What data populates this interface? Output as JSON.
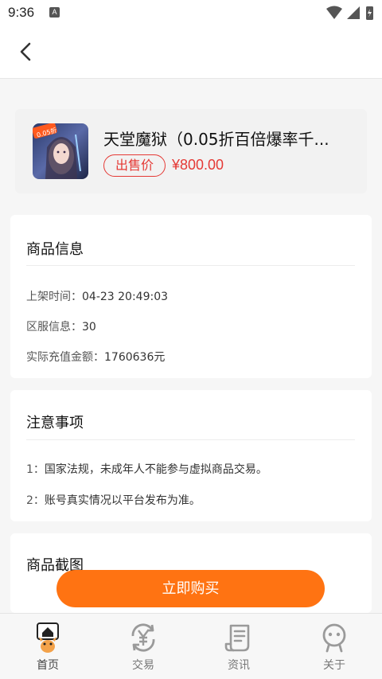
{
  "status_bar": {
    "time": "9:36",
    "notification_letter": "A"
  },
  "nav": {
    "back_icon": "chevron-left-icon"
  },
  "product": {
    "title": "天堂魔狱（0.05折百倍爆率千...",
    "sale_badge": "出售价",
    "price": "¥800.00",
    "thumbnail_badge": "0.05折"
  },
  "product_info": {
    "title": "商品信息",
    "rows": [
      {
        "label": "上架时间：",
        "value": "04-23 20:49:03"
      },
      {
        "label": "区服信息：",
        "value": "30"
      },
      {
        "label": "实际充值金额：",
        "value": "1760636元"
      }
    ]
  },
  "notes": {
    "title": "注意事项",
    "items": [
      {
        "num": "1：",
        "text": "国家法规，未成年人不能参与虚拟商品交易。"
      },
      {
        "num": "2：",
        "text": "账号真实情况以平台发布为准。"
      }
    ]
  },
  "screenshots": {
    "title": "商品截图"
  },
  "buy_button": "立即购买",
  "tabs": [
    {
      "label": "首页",
      "icon": "home-mascot-icon",
      "active": true
    },
    {
      "label": "交易",
      "icon": "yen-exchange-icon",
      "active": false
    },
    {
      "label": "资讯",
      "icon": "scroll-news-icon",
      "active": false
    },
    {
      "label": "关于",
      "icon": "face-icon",
      "active": false
    }
  ],
  "colors": {
    "accent": "#ff7312",
    "price_red": "#e53935"
  }
}
